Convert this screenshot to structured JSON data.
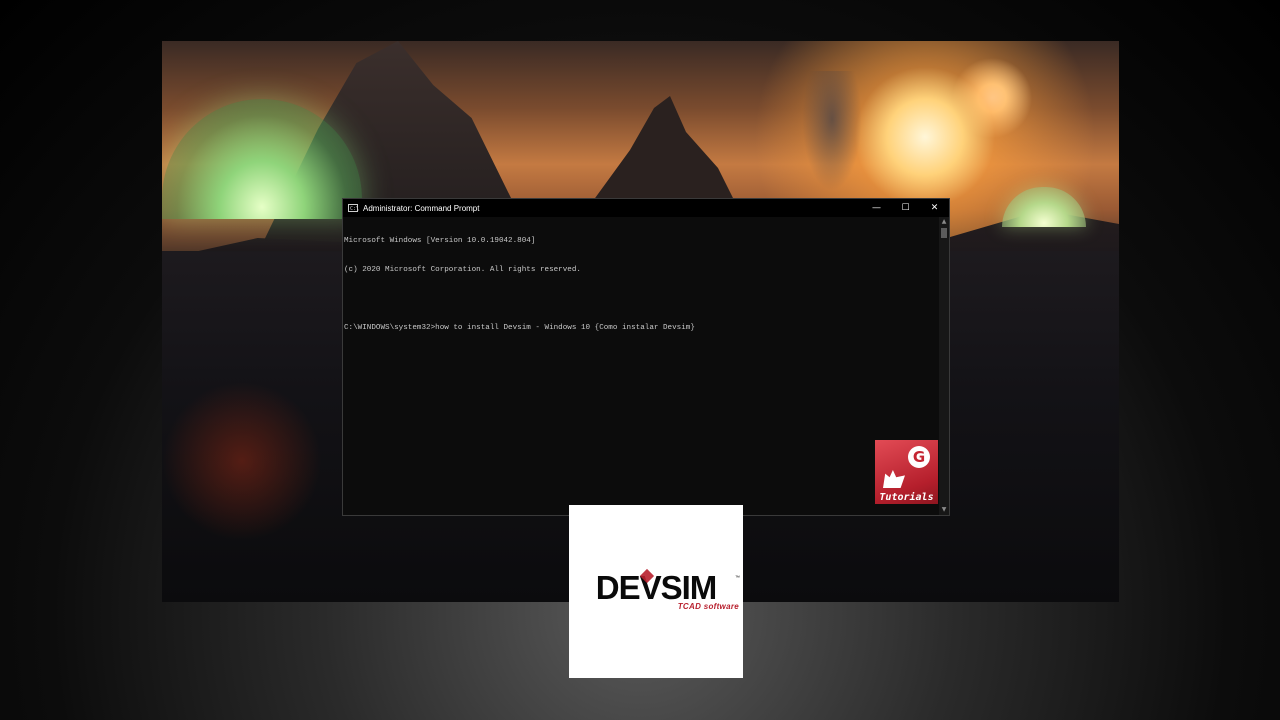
{
  "window": {
    "title": "Administrator: Command Prompt",
    "icon": "cmd-app-icon",
    "controls": {
      "minimize": "—",
      "maximize": "☐",
      "close": "✕"
    }
  },
  "console": {
    "lines": [
      "Microsoft Windows [Version 10.0.19042.804]",
      "(c) 2020 Microsoft Corporation. All rights reserved.",
      "",
      "C:\\WINDOWS\\system32>how to install Devsim - Windows 10 {Como instalar Devsim}"
    ]
  },
  "scrollbar": {
    "up_arrow": "▲",
    "down_arrow": "▼"
  },
  "badge": {
    "label": "Tutorials",
    "mark": "G",
    "color": "#c42532"
  },
  "logo": {
    "word": "DEVSIM",
    "trademark": "™",
    "tagline": "TCAD software",
    "accent": "#b8202e"
  }
}
